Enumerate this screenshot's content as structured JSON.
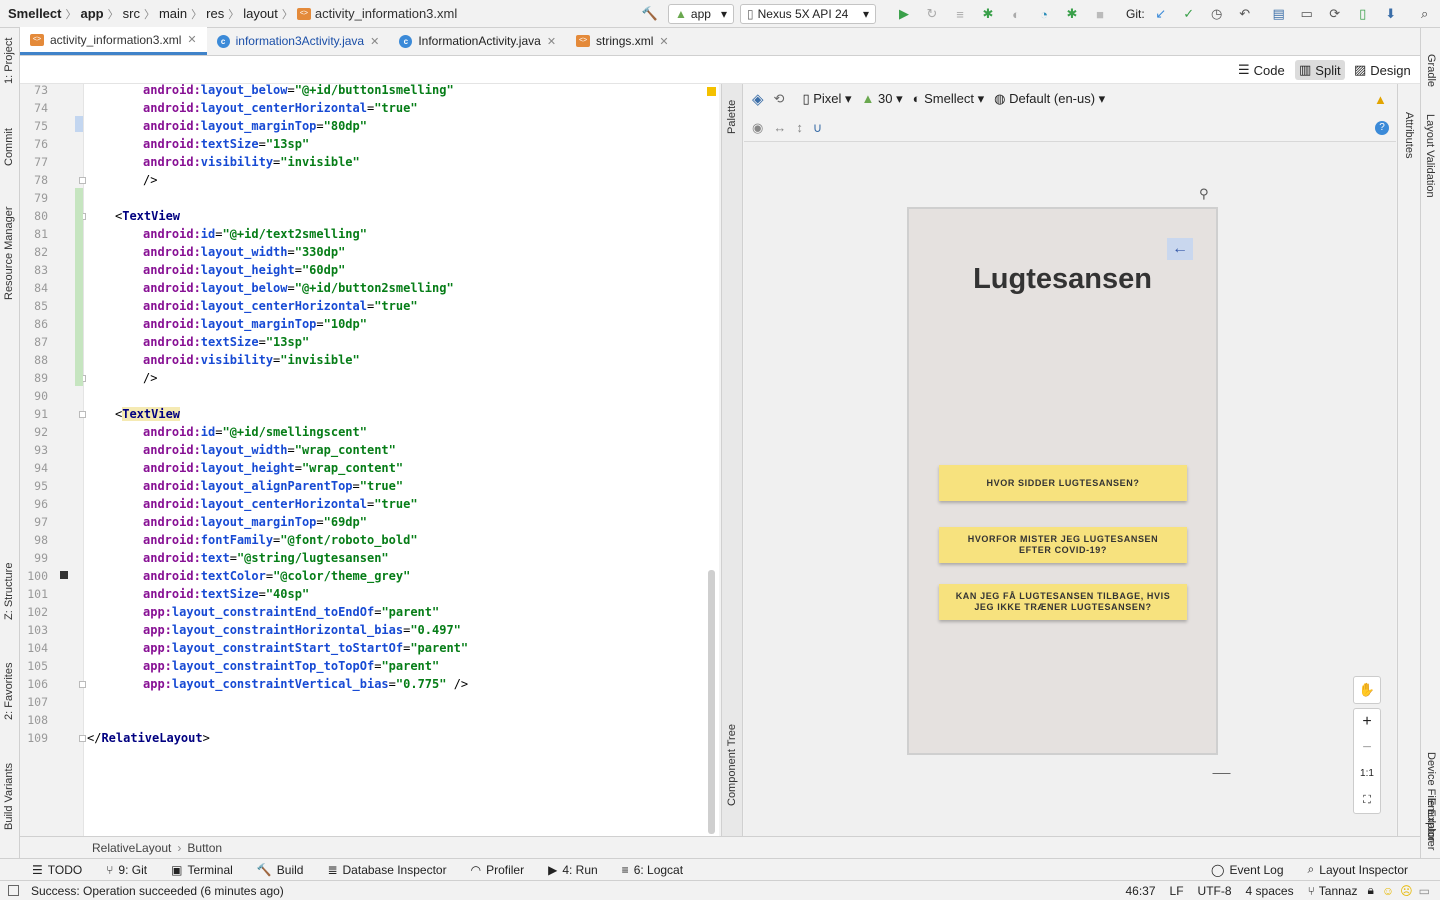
{
  "breadcrumb": [
    "Smellect",
    "app",
    "src",
    "main",
    "res",
    "layout",
    "activity_information3.xml"
  ],
  "toolbar": {
    "run_config": "app",
    "device": "Nexus 5X API 24",
    "git_label": "Git:"
  },
  "tabs": [
    {
      "label": "activity_information3.xml",
      "type": "xml",
      "active": true
    },
    {
      "label": "information3Activity.java",
      "type": "class",
      "active": false
    },
    {
      "label": "InformationActivity.java",
      "type": "class",
      "active": false
    },
    {
      "label": "strings.xml",
      "type": "xml",
      "active": false
    }
  ],
  "view_modes": {
    "code": "Code",
    "split": "Split",
    "design": "Design"
  },
  "left_tools": [
    "1: Project",
    "Commit",
    "Resource Manager",
    "Z: Structure",
    "2: Favorites",
    "Build Variants"
  ],
  "right_tools": [
    "Gradle",
    "Attributes",
    "Layout Validation",
    "Device File Explorer",
    "Emulator"
  ],
  "palette_label": "Palette",
  "component_tree_label": "Component Tree",
  "design_toolbar": {
    "device": "Pixel",
    "api": "30",
    "theme": "Smellect",
    "locale": "Default (en-us)"
  },
  "code_lines": [
    {
      "n": "73",
      "segs": [
        [
          "a",
          "android:"
        ],
        [
          "n",
          "layout_below"
        ],
        [
          "p",
          "="
        ],
        [
          "v",
          "\"@+id/button1smelling\""
        ]
      ],
      "indent": 2
    },
    {
      "n": "74",
      "segs": [
        [
          "a",
          "android:"
        ],
        [
          "n",
          "layout_centerHorizontal"
        ],
        [
          "p",
          "="
        ],
        [
          "v",
          "\"true\""
        ]
      ],
      "indent": 2
    },
    {
      "n": "75",
      "segs": [
        [
          "a",
          "android:"
        ],
        [
          "n",
          "layout_marginTop"
        ],
        [
          "p",
          "="
        ],
        [
          "v",
          "\"80dp\""
        ]
      ],
      "indent": 2
    },
    {
      "n": "76",
      "segs": [
        [
          "a",
          "android:"
        ],
        [
          "n",
          "textSize"
        ],
        [
          "p",
          "="
        ],
        [
          "v",
          "\"13sp\""
        ]
      ],
      "indent": 2
    },
    {
      "n": "77",
      "segs": [
        [
          "a",
          "android:"
        ],
        [
          "n",
          "visibility"
        ],
        [
          "p",
          "="
        ],
        [
          "v",
          "\"invisible\""
        ]
      ],
      "indent": 2
    },
    {
      "n": "78",
      "segs": [
        [
          "p",
          "/>"
        ]
      ],
      "indent": 2
    },
    {
      "n": "79",
      "segs": [],
      "indent": 0
    },
    {
      "n": "80",
      "segs": [
        [
          "p",
          "<"
        ],
        [
          "t",
          "TextView"
        ]
      ],
      "indent": 1
    },
    {
      "n": "81",
      "segs": [
        [
          "a",
          "android:"
        ],
        [
          "n",
          "id"
        ],
        [
          "p",
          "="
        ],
        [
          "v",
          "\"@+id/text2smelling\""
        ]
      ],
      "indent": 2
    },
    {
      "n": "82",
      "segs": [
        [
          "a",
          "android:"
        ],
        [
          "n",
          "layout_width"
        ],
        [
          "p",
          "="
        ],
        [
          "v",
          "\"330dp\""
        ]
      ],
      "indent": 2
    },
    {
      "n": "83",
      "segs": [
        [
          "a",
          "android:"
        ],
        [
          "n",
          "layout_height"
        ],
        [
          "p",
          "="
        ],
        [
          "v",
          "\"60dp\""
        ]
      ],
      "indent": 2
    },
    {
      "n": "84",
      "segs": [
        [
          "a",
          "android:"
        ],
        [
          "n",
          "layout_below"
        ],
        [
          "p",
          "="
        ],
        [
          "v",
          "\"@+id/button2smelling\""
        ]
      ],
      "indent": 2
    },
    {
      "n": "85",
      "segs": [
        [
          "a",
          "android:"
        ],
        [
          "n",
          "layout_centerHorizontal"
        ],
        [
          "p",
          "="
        ],
        [
          "v",
          "\"true\""
        ]
      ],
      "indent": 2
    },
    {
      "n": "86",
      "segs": [
        [
          "a",
          "android:"
        ],
        [
          "n",
          "layout_marginTop"
        ],
        [
          "p",
          "="
        ],
        [
          "v",
          "\"10dp\""
        ]
      ],
      "indent": 2
    },
    {
      "n": "87",
      "segs": [
        [
          "a",
          "android:"
        ],
        [
          "n",
          "textSize"
        ],
        [
          "p",
          "="
        ],
        [
          "v",
          "\"13sp\""
        ]
      ],
      "indent": 2
    },
    {
      "n": "88",
      "segs": [
        [
          "a",
          "android:"
        ],
        [
          "n",
          "visibility"
        ],
        [
          "p",
          "="
        ],
        [
          "v",
          "\"invisible\""
        ]
      ],
      "indent": 2
    },
    {
      "n": "89",
      "segs": [
        [
          "p",
          "/>"
        ]
      ],
      "indent": 2
    },
    {
      "n": "90",
      "segs": [],
      "indent": 0
    },
    {
      "n": "91",
      "segs": [
        [
          "p",
          "<"
        ],
        [
          "t",
          "TextView"
        ]
      ],
      "indent": 1
    },
    {
      "n": "92",
      "segs": [
        [
          "a",
          "android:"
        ],
        [
          "n",
          "id"
        ],
        [
          "p",
          "="
        ],
        [
          "v",
          "\"@+id/smellingscent\""
        ]
      ],
      "indent": 2
    },
    {
      "n": "93",
      "segs": [
        [
          "a",
          "android:"
        ],
        [
          "n",
          "layout_width"
        ],
        [
          "p",
          "="
        ],
        [
          "v",
          "\"wrap_content\""
        ]
      ],
      "indent": 2
    },
    {
      "n": "94",
      "segs": [
        [
          "a",
          "android:"
        ],
        [
          "n",
          "layout_height"
        ],
        [
          "p",
          "="
        ],
        [
          "v",
          "\"wrap_content\""
        ]
      ],
      "indent": 2
    },
    {
      "n": "95",
      "segs": [
        [
          "a",
          "android:"
        ],
        [
          "n",
          "layout_alignParentTop"
        ],
        [
          "p",
          "="
        ],
        [
          "v",
          "\"true\""
        ]
      ],
      "indent": 2
    },
    {
      "n": "96",
      "segs": [
        [
          "a",
          "android:"
        ],
        [
          "n",
          "layout_centerHorizontal"
        ],
        [
          "p",
          "="
        ],
        [
          "v",
          "\"true\""
        ]
      ],
      "indent": 2
    },
    {
      "n": "97",
      "segs": [
        [
          "a",
          "android:"
        ],
        [
          "n",
          "layout_marginTop"
        ],
        [
          "p",
          "="
        ],
        [
          "v",
          "\"69dp\""
        ]
      ],
      "indent": 2
    },
    {
      "n": "98",
      "segs": [
        [
          "a",
          "android:"
        ],
        [
          "n",
          "fontFamily"
        ],
        [
          "p",
          "="
        ],
        [
          "v",
          "\"@font/roboto_bold\""
        ]
      ],
      "indent": 2
    },
    {
      "n": "99",
      "segs": [
        [
          "a",
          "android:"
        ],
        [
          "n",
          "text"
        ],
        [
          "p",
          "="
        ],
        [
          "v",
          "\"@string/lugtesansen\""
        ]
      ],
      "indent": 2
    },
    {
      "n": "100",
      "segs": [
        [
          "a",
          "android:"
        ],
        [
          "n",
          "textColor"
        ],
        [
          "p",
          "="
        ],
        [
          "v",
          "\"@color/theme_grey\""
        ]
      ],
      "indent": 2
    },
    {
      "n": "101",
      "segs": [
        [
          "a",
          "android:"
        ],
        [
          "n",
          "textSize"
        ],
        [
          "p",
          "="
        ],
        [
          "v",
          "\"40sp\""
        ]
      ],
      "indent": 2
    },
    {
      "n": "102",
      "segs": [
        [
          "a",
          "app:"
        ],
        [
          "n",
          "layout_constraintEnd_toEndOf"
        ],
        [
          "p",
          "="
        ],
        [
          "v",
          "\"parent\""
        ]
      ],
      "indent": 2
    },
    {
      "n": "103",
      "segs": [
        [
          "a",
          "app:"
        ],
        [
          "n",
          "layout_constraintHorizontal_bias"
        ],
        [
          "p",
          "="
        ],
        [
          "v",
          "\"0.497\""
        ]
      ],
      "indent": 2
    },
    {
      "n": "104",
      "segs": [
        [
          "a",
          "app:"
        ],
        [
          "n",
          "layout_constraintStart_toStartOf"
        ],
        [
          "p",
          "="
        ],
        [
          "v",
          "\"parent\""
        ]
      ],
      "indent": 2
    },
    {
      "n": "105",
      "segs": [
        [
          "a",
          "app:"
        ],
        [
          "n",
          "layout_constraintTop_toTopOf"
        ],
        [
          "p",
          "="
        ],
        [
          "v",
          "\"parent\""
        ]
      ],
      "indent": 2
    },
    {
      "n": "106",
      "segs": [
        [
          "a",
          "app:"
        ],
        [
          "n",
          "layout_constraintVertical_bias"
        ],
        [
          "p",
          "="
        ],
        [
          "v",
          "\"0.775\""
        ],
        [
          "p",
          " />"
        ]
      ],
      "indent": 2
    },
    {
      "n": "107",
      "segs": [],
      "indent": 0
    },
    {
      "n": "108",
      "segs": [],
      "indent": 0
    },
    {
      "n": "109",
      "segs": [
        [
          "p",
          "</"
        ],
        [
          "t",
          "RelativeLayout"
        ],
        [
          "p",
          ">"
        ]
      ],
      "indent": 0
    }
  ],
  "preview": {
    "title": "Lugtesansen",
    "buttons": [
      "HVOR SIDDER LUGTESANSEN?",
      "HVORFOR MISTER JEG LUGTESANSEN EFTER COVID-19?",
      "KAN JEG FÅ LUGTESANSEN TILBAGE, HVIS JEG IKKE TRÆNER LUGTESANSEN?"
    ]
  },
  "zoom_controls": {
    "fit": "1:1"
  },
  "editor_breadcrumb": [
    "RelativeLayout",
    "Button"
  ],
  "tool_windows_left": [
    {
      "label": "TODO",
      "icon": "list-icon"
    },
    {
      "label": "9: Git",
      "icon": "git-icon"
    },
    {
      "label": "Terminal",
      "icon": "terminal-icon"
    },
    {
      "label": "Build",
      "icon": "hammer-icon"
    },
    {
      "label": "Database Inspector",
      "icon": "database-icon"
    },
    {
      "label": "Profiler",
      "icon": "gauge-icon"
    },
    {
      "label": "4: Run",
      "icon": "play-icon"
    },
    {
      "label": "6: Logcat",
      "icon": "logcat-icon"
    }
  ],
  "tool_windows_right": [
    {
      "label": "Event Log",
      "icon": "bubble-icon"
    },
    {
      "label": "Layout Inspector",
      "icon": "inspect-icon"
    }
  ],
  "status": {
    "message": "Success: Operation succeeded (6 minutes ago)",
    "position": "46:37",
    "line_sep": "LF",
    "encoding": "UTF-8",
    "indent": "4 spaces",
    "branch": "Tannaz"
  },
  "colors": {
    "accent": "#4083c9",
    "button_yellow": "#f7e27e",
    "preview_bg": "#e5e1df"
  }
}
